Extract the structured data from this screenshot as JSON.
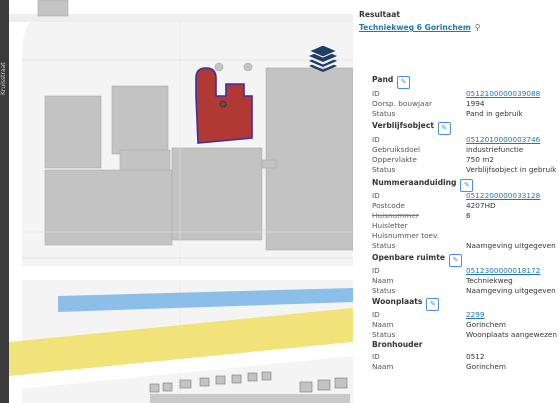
{
  "map": {
    "colors": {
      "background": "#f4f4f4",
      "road": "#ffffff",
      "building": "#c3c3c3",
      "selected_building": "#b03a33",
      "selected_outline": "#3a2fa0",
      "water": "#8bbee8",
      "beach": "#f2e27a"
    },
    "left_edge_label": "Kruisstraat",
    "layers_button_icon": "layers-icon"
  },
  "panel": {
    "heading": "Resultaat",
    "address": "Techniekweg 6 Gorinchem",
    "address_icon": "location-pin-icon",
    "sections": {
      "pand": {
        "title": "Pand",
        "rows": [
          {
            "key": "ID",
            "value": "0512100000039088"
          },
          {
            "key": "Oorsp. bouwjaar",
            "value": "1994"
          },
          {
            "key": "Status",
            "value": "Pand in gebruik"
          }
        ]
      },
      "verblijfsobject": {
        "title": "Verblijfsobject",
        "rows": [
          {
            "key": "ID",
            "value": "0512010000003746"
          },
          {
            "key": "Gebruiksdoel",
            "value": "industriefunctie"
          },
          {
            "key": "Oppervlakte",
            "value": "750 m2"
          },
          {
            "key": "Status",
            "value": "Verblijfsobject in gebruik"
          }
        ]
      },
      "nummeraanduiding": {
        "title": "Nummeraanduiding",
        "rows": [
          {
            "key": "ID",
            "value": "0512200000033128"
          },
          {
            "key": "Postcode",
            "value": "4207HD"
          },
          {
            "key": "Huisnummer",
            "value": "6"
          },
          {
            "key": "Huisletter",
            "value": ""
          },
          {
            "key": "Huisnummer toev.",
            "value": ""
          },
          {
            "key": "Status",
            "value": "Naamgeving uitgegeven"
          }
        ]
      },
      "openbare_ruimte": {
        "title": "Openbare ruimte",
        "rows": [
          {
            "key": "ID",
            "value": "0512300000018172"
          },
          {
            "key": "Naam",
            "value": "Techniekweg"
          },
          {
            "key": "Status",
            "value": "Naamgeving uitgegeven"
          }
        ]
      },
      "woonplaats": {
        "title": "Woonplaats",
        "rows": [
          {
            "key": "ID",
            "value": "2299"
          },
          {
            "key": "Naam",
            "value": "Gorinchem"
          },
          {
            "key": "Status",
            "value": "Woonplaats aangewezen"
          }
        ]
      },
      "bronhouder": {
        "title": "Bronhouder",
        "rows": [
          {
            "key": "ID",
            "value": "0512"
          },
          {
            "key": "Naam",
            "value": "Gorinchem"
          }
        ]
      }
    },
    "edit_icon": "edit-pencil-icon",
    "link_color": "#1f78b4"
  }
}
